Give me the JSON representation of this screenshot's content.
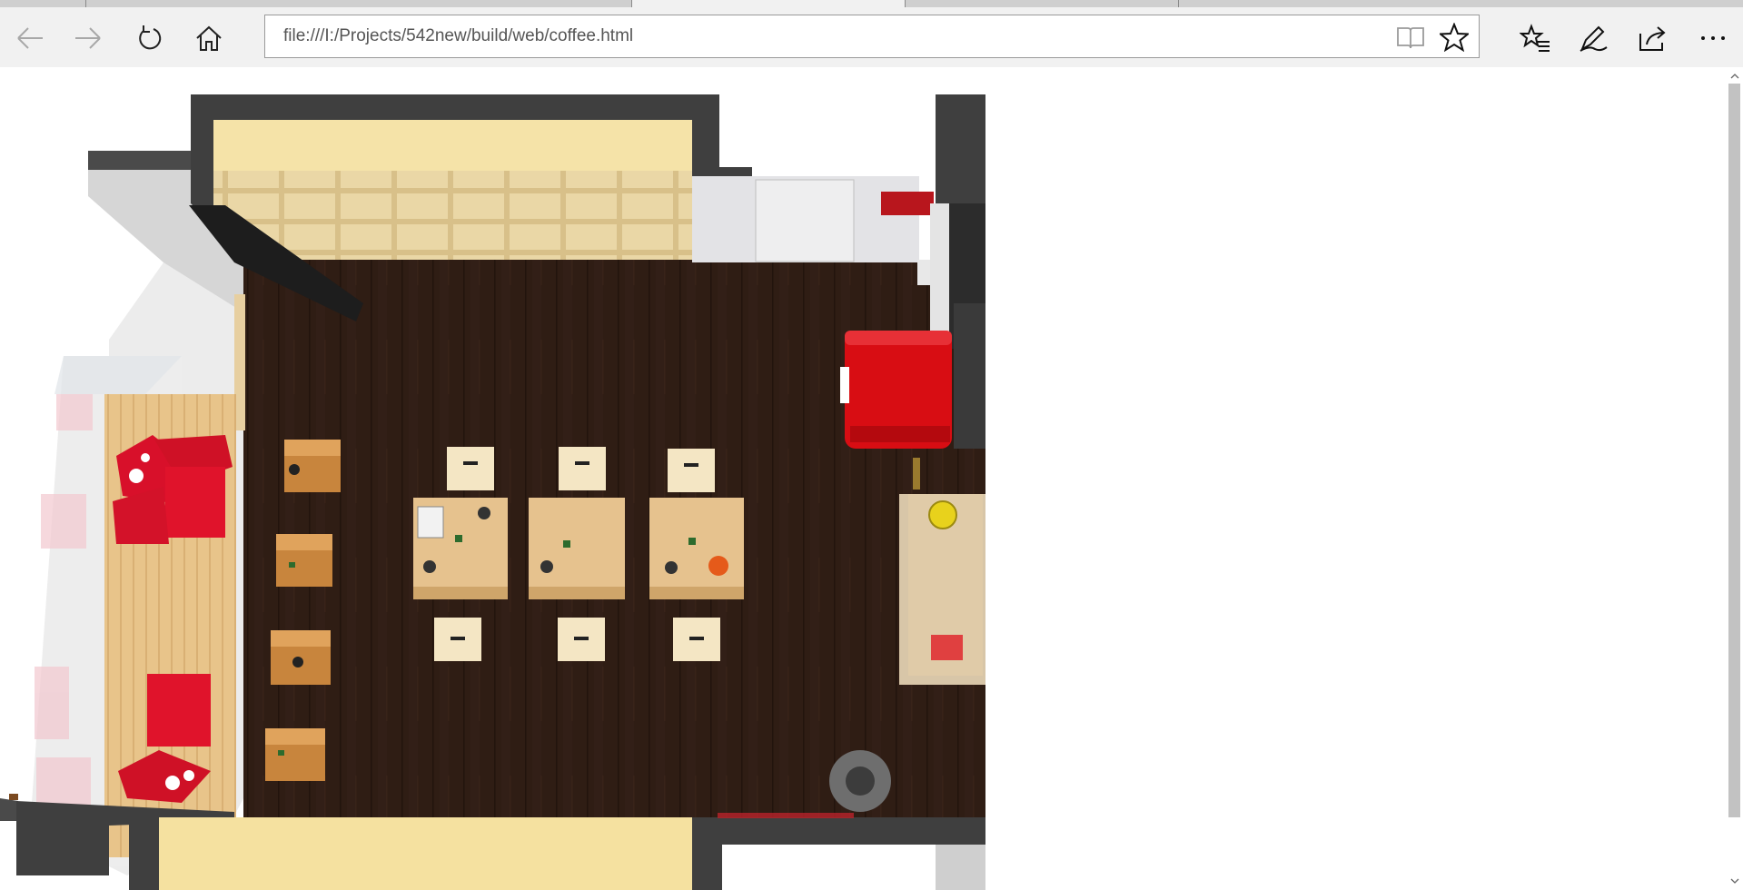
{
  "browser": {
    "tabs": [
      {
        "state": "inactive"
      },
      {
        "state": "inactive"
      },
      {
        "state": "active"
      },
      {
        "state": "inactive"
      },
      {
        "state": "inactive"
      }
    ],
    "toolbar": {
      "back_icon": "back-arrow-icon",
      "forward_icon": "forward-arrow-icon",
      "refresh_icon": "refresh-icon",
      "home_icon": "home-icon",
      "reading_view_icon": "book-icon",
      "favorite_icon": "star-icon",
      "favorites_hub_icon": "favorites-list-icon",
      "web_notes_icon": "pen-icon",
      "share_icon": "share-icon",
      "more_icon": "ellipsis-icon"
    },
    "address_bar": {
      "url": "file:///I:/Projects/542new/build/web/coffee.html"
    }
  },
  "page": {
    "image": {
      "description_icon": "coffee-shop-floor-plan-render",
      "colors": {
        "floor": "#2f1d14",
        "walls": "#454545",
        "shelf": "#e9d29a",
        "accent_red": "#d0101a",
        "table_wood": "#e6c28e"
      }
    }
  }
}
